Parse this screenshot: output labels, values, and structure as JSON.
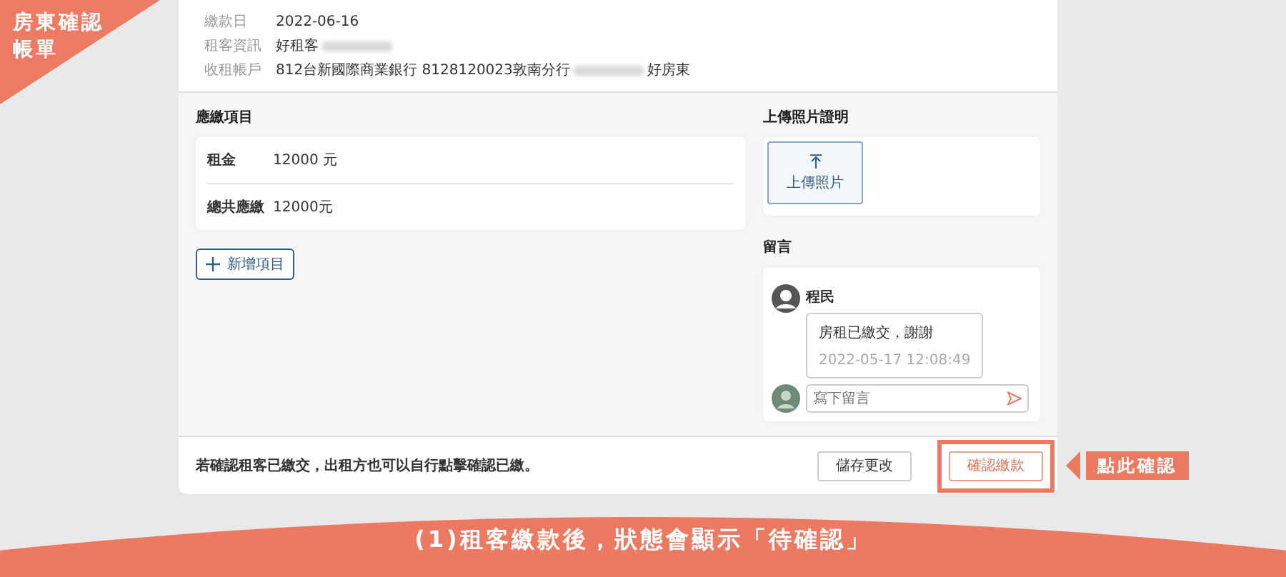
{
  "corner_label": {
    "lines": [
      "房東確認",
      "帳單"
    ]
  },
  "bill_info": [
    {
      "label": "繳款日",
      "parts": [
        {
          "kind": "text",
          "text": "2022-06-16"
        }
      ]
    },
    {
      "label": "租客資訊",
      "parts": [
        {
          "kind": "text",
          "text": "好租客"
        },
        {
          "kind": "blur"
        }
      ]
    },
    {
      "label": "收租帳戶",
      "parts": [
        {
          "kind": "text",
          "text": "812台新國際商業銀行 8128120023敦南分行"
        },
        {
          "kind": "blur"
        },
        {
          "kind": "text",
          "text": "好房東"
        }
      ]
    }
  ],
  "items_section": {
    "title": "應繳項目",
    "rows": [
      {
        "label": "租金",
        "value": "12000 元"
      },
      {
        "label": "總共應繳",
        "value": "12000元"
      }
    ],
    "add_button": "新增項目"
  },
  "photo_section": {
    "title": "上傳照片證明",
    "upload_button": "上傳照片"
  },
  "comments": {
    "title": "留言",
    "messages": [
      {
        "author": "程民",
        "text": "房租已繳交，謝謝",
        "time": "2022-05-17 12:08:49"
      }
    ],
    "input": {
      "placeholder": "寫下留言"
    }
  },
  "footer": {
    "note": "若確認租客已繳交，出租方也可以自行點擊確認已繳。",
    "buttons": [
      {
        "label": "儲存更改",
        "kind": "secondary",
        "highlighted": false
      },
      {
        "label": "確認繳款",
        "kind": "primary",
        "highlighted": true
      }
    ]
  },
  "callout": {
    "text": "點此確認"
  },
  "banner": {
    "text": "(1)租客繳款後，狀態會顯示「待確認」"
  }
}
